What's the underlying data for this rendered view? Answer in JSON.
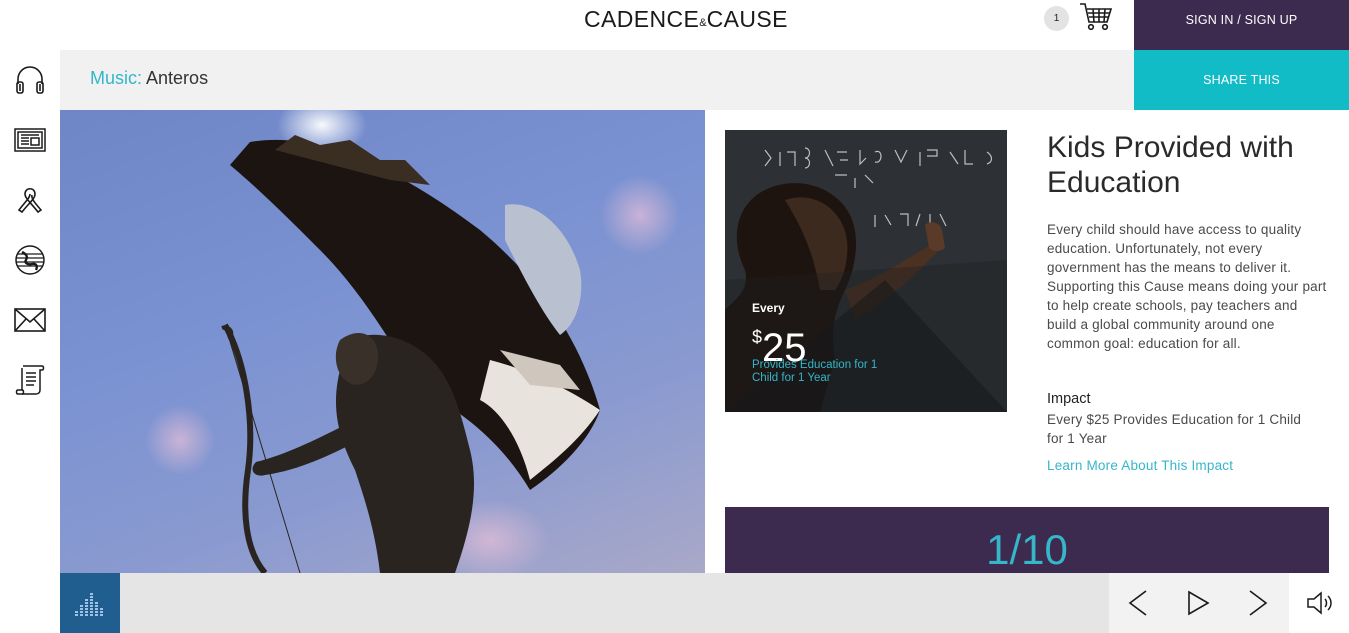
{
  "header": {
    "logo_left": "CADENCE",
    "logo_amp": "&",
    "logo_right": "CAUSE",
    "cart_count": "1",
    "cart_icon": "cart-icon",
    "sign_in_label": "SIGN IN / SIGN UP"
  },
  "breadcrumb": {
    "category": "Music:",
    "name": "Anteros"
  },
  "share_label": "SHARE THIS",
  "sidebar": {
    "items": [
      {
        "icon": "headphones-icon"
      },
      {
        "icon": "newspaper-icon"
      },
      {
        "icon": "ribbon-icon"
      },
      {
        "icon": "globe-icon"
      },
      {
        "icon": "envelope-icon"
      },
      {
        "icon": "scroll-icon"
      }
    ]
  },
  "hero": {
    "alt": "Anteros statue"
  },
  "cause": {
    "image_every": "Every",
    "image_dollar": "$",
    "image_amount": "25",
    "image_small": "Provides Education for 1 Child for 1 Year",
    "title": "Kids Provided with Education",
    "description": "Every child should have access to quality education. Unfortunately, not every government has the means to deliver it. Supporting this Cause means doing your part to help create schools, pay teachers and build a global community around one common goal: education for all.",
    "impact_heading": "Impact",
    "impact_text": "Every $25 Provides Education for 1 Child for 1 Year",
    "learn_more": "Learn More About This Impact"
  },
  "counter": {
    "text": "1/10"
  },
  "player": {
    "eq_icon": "equalizer-icon",
    "prev_icon": "chevron-left-icon",
    "play_icon": "play-icon",
    "next_icon": "chevron-right-icon",
    "volume_icon": "speaker-icon"
  },
  "colors": {
    "purple": "#3d2b4f",
    "teal": "#12bcc7",
    "accent_text": "#35b6c9",
    "player_blue": "#1f5e8f"
  }
}
